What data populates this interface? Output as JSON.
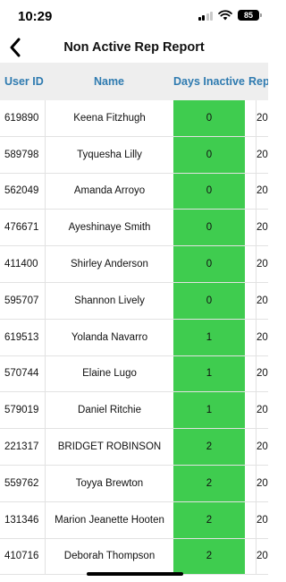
{
  "status": {
    "time": "10:29",
    "battery": "85"
  },
  "header": {
    "title": "Non Active Rep Report"
  },
  "table": {
    "columns": {
      "user_id": "User ID",
      "name": "Name",
      "days_inactive": "Days Inactive",
      "rep": "Rep"
    },
    "days_cell_color": "#3fcc4f",
    "rows": [
      {
        "user_id": "619890",
        "name": "Keena Fitzhugh",
        "days": "0",
        "rep": "20"
      },
      {
        "user_id": "589798",
        "name": "Tyquesha Lilly",
        "days": "0",
        "rep": "20"
      },
      {
        "user_id": "562049",
        "name": "Amanda  Arroyo",
        "days": "0",
        "rep": "20"
      },
      {
        "user_id": "476671",
        "name": "Ayeshinaye Smith",
        "days": "0",
        "rep": "20"
      },
      {
        "user_id": "411400",
        "name": "Shirley Anderson",
        "days": "0",
        "rep": "20"
      },
      {
        "user_id": "595707",
        "name": "Shannon Lively",
        "days": "0",
        "rep": "20"
      },
      {
        "user_id": "619513",
        "name": "Yolanda Navarro",
        "days": "1",
        "rep": "20"
      },
      {
        "user_id": "570744",
        "name": "Elaine Lugo",
        "days": "1",
        "rep": "20"
      },
      {
        "user_id": "579019",
        "name": "Daniel Ritchie",
        "days": "1",
        "rep": "20"
      },
      {
        "user_id": "221317",
        "name": "BRIDGET ROBINSON",
        "days": "2",
        "rep": "20"
      },
      {
        "user_id": "559762",
        "name": "Toyya Brewton",
        "days": "2",
        "rep": "20"
      },
      {
        "user_id": "131346",
        "name": "Marion Jeanette Hooten",
        "days": "2",
        "rep": "20"
      },
      {
        "user_id": "410716",
        "name": "Deborah Thompson",
        "days": "2",
        "rep": "20"
      }
    ]
  }
}
